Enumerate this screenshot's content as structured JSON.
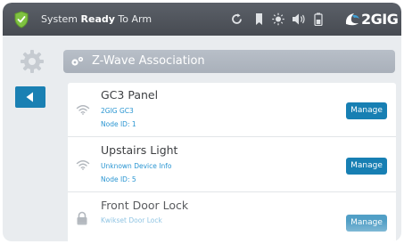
{
  "status_bar": {
    "status_prefix": "System ",
    "status_bold": "Ready",
    "status_suffix": " To Arm",
    "brand": "2GIG"
  },
  "header": {
    "title": "Z-Wave Association"
  },
  "devices": [
    {
      "name": "GC3 Panel",
      "type": "2GIG GC3",
      "node": "Node ID: 1",
      "icon": "wifi-icon",
      "action": "Manage"
    },
    {
      "name": "Upstairs Light",
      "type": "Unknown Device Info",
      "node": "Node ID: 5",
      "icon": "wifi-icon",
      "action": "Manage"
    },
    {
      "name": "Front Door Lock",
      "type": "Kwikset Door Lock",
      "node": "",
      "icon": "lock-icon",
      "action": "Manage"
    }
  ],
  "colors": {
    "accent": "#177fb3",
    "link_text": "#2b96d2",
    "status_bar": "#4f535a",
    "shield": "#7fc241"
  }
}
